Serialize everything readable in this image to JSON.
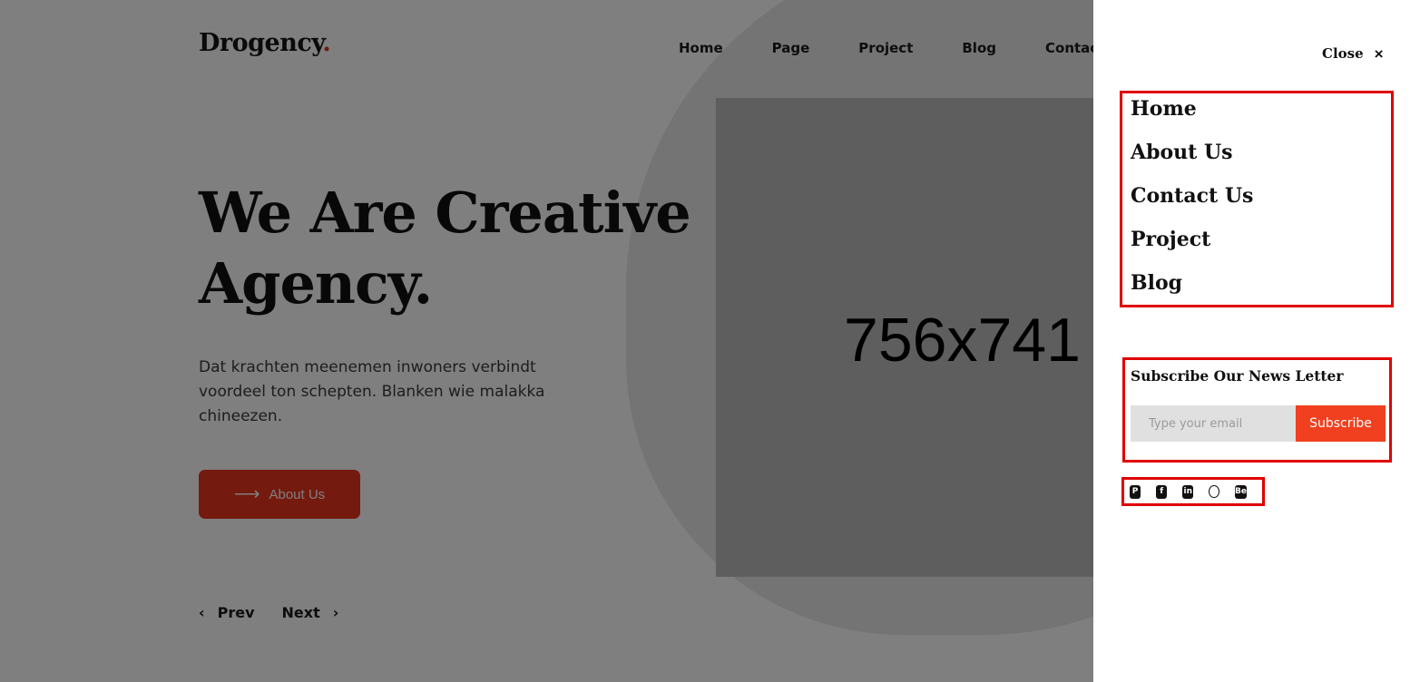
{
  "header": {
    "logo_text": "Drogency",
    "logo_dot": ".",
    "nav": [
      "Home",
      "Page",
      "Project",
      "Blog",
      "Contact"
    ]
  },
  "hero": {
    "title_line1": "We Are Creative",
    "title_line2": "Agency.",
    "description": "Dat krachten meenemen inwoners verbindt voordeel ton schepten. Blanken wie malakka chineezen.",
    "cta_label": "About Us",
    "cta_icon": "arrow-right-icon"
  },
  "slider": {
    "prev": "Prev",
    "next": "Next"
  },
  "image_placeholder": {
    "label": "756x741"
  },
  "drawer": {
    "close_label": "Close",
    "close_icon": "×",
    "menu": [
      "Home",
      "About Us",
      "Contact Us",
      "Project",
      "Blog"
    ],
    "newsletter": {
      "title": "Subscribe Our News Letter",
      "placeholder": "Type your email",
      "button": "Subscribe"
    },
    "social": [
      "pinterest-icon",
      "facebook-icon",
      "linkedin-icon",
      "dribbble-icon",
      "behance-icon"
    ]
  },
  "colors": {
    "accent": "#e8341c",
    "highlight_border": "#e00000",
    "overlay": "rgba(0,0,0,0.5)"
  }
}
